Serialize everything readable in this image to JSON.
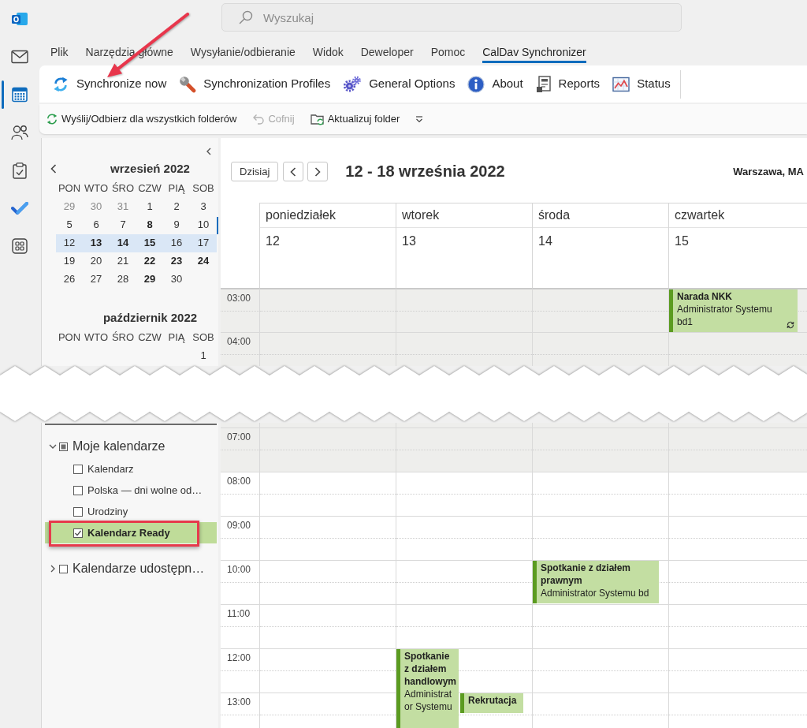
{
  "app_bar": [
    {
      "kind": "logo",
      "selected": false
    },
    {
      "kind": "mail",
      "selected": false
    },
    {
      "kind": "calendar",
      "selected": true
    },
    {
      "kind": "people",
      "selected": false
    },
    {
      "kind": "tasks",
      "selected": false
    },
    {
      "kind": "todo",
      "selected": false
    },
    {
      "kind": "apps",
      "selected": false
    }
  ],
  "search": {
    "placeholder": "Wyszukaj"
  },
  "menu_tabs": [
    {
      "label": "Plik",
      "selected": false
    },
    {
      "label": "Narzędzia główne",
      "selected": false
    },
    {
      "label": "Wysyłanie/odbieranie",
      "selected": false
    },
    {
      "label": "Widok",
      "selected": false
    },
    {
      "label": "Deweloper",
      "selected": false
    },
    {
      "label": "Pomoc",
      "selected": false
    },
    {
      "label": "CalDav Synchronizer",
      "selected": true
    }
  ],
  "ribbon": [
    {
      "kind": "sync",
      "label": "Synchronize now"
    },
    {
      "kind": "wrench",
      "label": "Synchronization Profiles"
    },
    {
      "kind": "gears",
      "label": "General Options"
    },
    {
      "kind": "info",
      "label": "About"
    },
    {
      "kind": "report",
      "label": "Reports"
    },
    {
      "kind": "chart",
      "label": "Status"
    }
  ],
  "quick_access": [
    {
      "kind": "sync",
      "label": "Wyślij/Odbierz dla wszystkich folderów",
      "disabled": false
    },
    {
      "kind": "undo",
      "label": "Cofnij",
      "disabled": true
    },
    {
      "kind": "folder",
      "label": "Aktualizuj folder",
      "disabled": false
    }
  ],
  "mini_calendars": [
    {
      "title": "wrzesień 2022",
      "weekdays": [
        "PON",
        "WTO",
        "ŚRO",
        "CZW",
        "PIĄ",
        "SOB"
      ],
      "weeks": [
        {
          "kind": "regular",
          "selected": false,
          "days": [
            {
              "day": "29",
              "other_month": true,
              "bold": false
            },
            {
              "day": "30",
              "other_month": true,
              "bold": false
            },
            {
              "day": "31",
              "other_month": true,
              "bold": false
            },
            {
              "day": "1",
              "other_month": false,
              "bold": false
            },
            {
              "day": "2",
              "other_month": false,
              "bold": false
            },
            {
              "day": "3",
              "other_month": false,
              "bold": false
            }
          ]
        },
        {
          "kind": "regular",
          "selected": false,
          "days": [
            {
              "day": "5",
              "other_month": false,
              "bold": false
            },
            {
              "day": "6",
              "other_month": false,
              "bold": false
            },
            {
              "day": "7",
              "other_month": false,
              "bold": false
            },
            {
              "day": "8",
              "other_month": false,
              "bold": true
            },
            {
              "day": "9",
              "other_month": false,
              "bold": false
            },
            {
              "day": "10",
              "other_month": false,
              "bold": false
            }
          ]
        },
        {
          "kind": "regular",
          "selected": true,
          "days": [
            {
              "day": "12",
              "other_month": false,
              "bold": false
            },
            {
              "day": "13",
              "other_month": false,
              "bold": true
            },
            {
              "day": "14",
              "other_month": false,
              "bold": true
            },
            {
              "day": "15",
              "other_month": false,
              "bold": true
            },
            {
              "day": "16",
              "other_month": false,
              "bold": false
            },
            {
              "day": "17",
              "other_month": false,
              "bold": false
            }
          ]
        },
        {
          "kind": "regular",
          "selected": false,
          "days": [
            {
              "day": "19",
              "other_month": false,
              "bold": false
            },
            {
              "day": "20",
              "other_month": false,
              "bold": false
            },
            {
              "day": "21",
              "other_month": false,
              "bold": false
            },
            {
              "day": "22",
              "other_month": false,
              "bold": true
            },
            {
              "day": "23",
              "other_month": false,
              "bold": true
            },
            {
              "day": "24",
              "other_month": false,
              "bold": true
            }
          ]
        },
        {
          "kind": "regular",
          "selected": false,
          "days": [
            {
              "day": "26",
              "other_month": false,
              "bold": false
            },
            {
              "day": "27",
              "other_month": false,
              "bold": false
            },
            {
              "day": "28",
              "other_month": false,
              "bold": false
            },
            {
              "day": "29",
              "other_month": false,
              "bold": true
            },
            {
              "day": "30",
              "other_month": false,
              "bold": false
            }
          ]
        }
      ]
    },
    {
      "title": "październik 2022",
      "weekdays": [
        "PON",
        "WTO",
        "ŚRO",
        "CZW",
        "PIĄ",
        "SOB"
      ],
      "weeks": [
        {
          "kind": "month_start",
          "selected": false,
          "days": [
            {
              "day": "1",
              "other_month": false,
              "bold": false
            }
          ]
        }
      ]
    }
  ],
  "calendar_tree": [
    {
      "label": "Moje kalendarze",
      "expanded": true,
      "checked": false,
      "partial": true,
      "children": [
        {
          "label": "Kalendarz",
          "checked": false,
          "selected": false,
          "highlighted": false
        },
        {
          "label": "Polska — dni wolne od…",
          "checked": false,
          "selected": false,
          "highlighted": false
        },
        {
          "label": "Urodziny",
          "checked": false,
          "selected": false,
          "highlighted": false
        },
        {
          "label": "Kalendarz Ready",
          "checked": true,
          "selected": true,
          "highlighted": true
        }
      ]
    },
    {
      "label": "Kalendarze udostępn…",
      "expanded": false,
      "checked": false,
      "partial": false
    }
  ],
  "week_view": {
    "today_button": "Dzisiaj",
    "title": "12 - 18 września 2022",
    "location": "Warszawa, MA",
    "days": [
      {
        "name": "poniedziałek",
        "date": "12"
      },
      {
        "name": "wtorek",
        "date": "13"
      },
      {
        "name": "środa",
        "date": "14"
      },
      {
        "name": "czwartek",
        "date": "15"
      }
    ],
    "rows_top": [
      {
        "kind": "hour",
        "time": "03:00",
        "cells": [
          {
            "working": false
          },
          {
            "working": false
          },
          {
            "working": false
          },
          {
            "working": false,
            "events": [
              {
                "kind": "hour",
                "title": "Narada NKK",
                "details": "Administrator Systemu bd1",
                "recurring": true,
                "narrow": false,
                "shifted": false
              }
            ]
          }
        ]
      },
      {
        "kind": "hour",
        "time": "04:00",
        "cells": [
          {
            "working": false
          },
          {
            "working": false
          },
          {
            "working": false
          },
          {
            "working": false
          }
        ]
      }
    ],
    "rows_bottom": [
      {
        "kind": "partial",
        "cells": [
          {
            "working": false
          },
          {
            "working": false
          },
          {
            "working": false
          },
          {
            "working": false
          }
        ]
      },
      {
        "kind": "hour",
        "time": "07:00",
        "cells": [
          {
            "working": false
          },
          {
            "working": false
          },
          {
            "working": false
          },
          {
            "working": false
          }
        ]
      },
      {
        "kind": "hour",
        "time": "08:00",
        "cells": [
          {
            "working": true
          },
          {
            "working": true
          },
          {
            "working": true
          },
          {
            "working": true
          }
        ]
      },
      {
        "kind": "hour",
        "time": "09:00",
        "cells": [
          {
            "working": true
          },
          {
            "working": true
          },
          {
            "working": true
          },
          {
            "working": true
          }
        ]
      },
      {
        "kind": "hour",
        "time": "10:00",
        "cells": [
          {
            "working": true
          },
          {
            "working": true
          },
          {
            "working": true,
            "events": [
              {
                "kind": "hour",
                "title": "Spotkanie z działem prawnym",
                "details": "Administrator Systemu bd",
                "recurring": false,
                "narrow": false,
                "shifted": false
              }
            ]
          },
          {
            "working": true
          }
        ]
      },
      {
        "kind": "hour",
        "time": "11:00",
        "cells": [
          {
            "working": true
          },
          {
            "working": true
          },
          {
            "working": true
          },
          {
            "working": true
          }
        ]
      },
      {
        "kind": "hour",
        "time": "12:00",
        "cells": [
          {
            "working": true
          },
          {
            "working": true,
            "events": [
              {
                "kind": "open",
                "title": "Spotkanie z działem handlowym",
                "details": "Administrator Systemu",
                "recurring": false,
                "narrow": true,
                "shifted": false
              }
            ]
          },
          {
            "working": true
          },
          {
            "working": true
          }
        ]
      },
      {
        "kind": "hour",
        "time": "13:00",
        "cells": [
          {
            "working": true
          },
          {
            "working": true,
            "events": [
              {
                "kind": "half",
                "title": "Rekrutacja",
                "recurring": false,
                "narrow": true,
                "shifted": true
              }
            ]
          },
          {
            "working": true
          },
          {
            "working": true
          }
        ]
      }
    ]
  }
}
